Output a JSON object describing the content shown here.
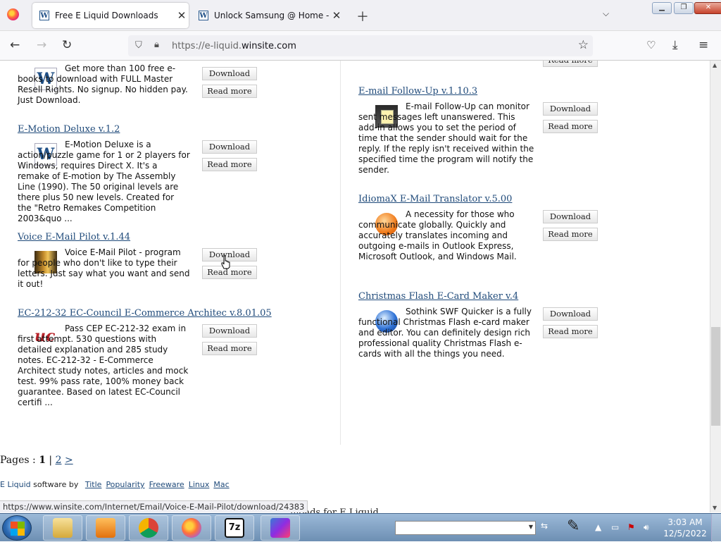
{
  "browser": {
    "tabs": [
      {
        "title": "Free E Liquid Downloads",
        "active": true
      },
      {
        "title": "Unlock Samsung @ Home - FRE",
        "active": false
      }
    ],
    "url_prefix": "https://e-liquid.",
    "url_domain": "winsite.com",
    "url_suffix": ""
  },
  "left_items": [
    {
      "title": "",
      "desc": "Get more than 100 free e-books to download with FULL Master Resell Rights. No signup. No hidden pay. Just Download.",
      "download": "Download",
      "read_more": "Read more"
    },
    {
      "title": "E-Motion Deluxe  v.1.2",
      "desc": "E-Motion Deluxe is a action/puzzle game for 1 or 2 players for Windows, requires Direct X. It's a remake of E-motion by The Assembly Line (1990). The 50 original levels are there plus 50 new levels. Created for the \"Retro Remakes Competition 2003&quo ...",
      "download": "Download",
      "read_more": "Read more"
    },
    {
      "title": "Voice E-Mail Pilot  v.1.44",
      "desc": "Voice E-Mail Pilot - program for people who don't like to type their letters. Just say what you want and send it out!",
      "download": "Download",
      "read_more": "Read more"
    },
    {
      "title": "EC-212-32 EC-Council E-Commerce Architec  v.8.01.05",
      "desc": "Pass CEP EC-212-32 exam in first attempt. 530 questions with detailed explanation and 285 study notes. EC-212-32 - E-Commerce Architect study notes, articles and mock test. 99% pass rate, 100% money back guarantee. Based on latest EC-Council certifi ...",
      "download": "Download",
      "read_more": "Read more"
    }
  ],
  "right_items": [
    {
      "title": "",
      "desc": "",
      "download": "",
      "read_more": "Read more"
    },
    {
      "title": "E-mail Follow-Up  v.1.10.3",
      "desc": "E-mail Follow-Up can monitor sent messages left unanswered. This add-in allows you to set the period of time that the sender should wait for the reply. If the reply isn't received within the specified time the program will notify the sender.",
      "download": "Download",
      "read_more": "Read more"
    },
    {
      "title": "IdiomaX E-Mail Translator  v.5.00",
      "desc": "A necessity for those who communicate globally. Quickly and accurately translates incoming and outgoing e-mails in Outlook Express, Microsoft Outlook, and Windows Mail.",
      "download": "Download",
      "read_more": "Read more"
    },
    {
      "title": "Christmas Flash E-Card Maker  v.4",
      "desc": "Sothink SWF Quicker is a fully functional Christmas Flash e-card maker and editor. You can definitely design rich professional quality Christmas Flash e-cards with all the things you need.",
      "download": "Download",
      "read_more": "Read more"
    }
  ],
  "pager": {
    "label": "Pages : ",
    "current": "1",
    "sep": " | ",
    "next_page": "2",
    "next_arrow": ">"
  },
  "software_by": {
    "brand": "E Liquid",
    "text": " software by ",
    "links": [
      "Title",
      "Popularity",
      "Freeware",
      "Linux",
      "Mac"
    ]
  },
  "status_url": "https://www.winsite.com/Internet/Email/Voice-E-Mail-Pilot/download/24383",
  "behind_text": "nloads for E Liquid",
  "taskbar": {
    "time": "3:03 AM",
    "date": "12/5/2022",
    "apps": [
      "file-explorer",
      "media-player",
      "chrome",
      "firefox",
      "7zip",
      "app"
    ]
  }
}
